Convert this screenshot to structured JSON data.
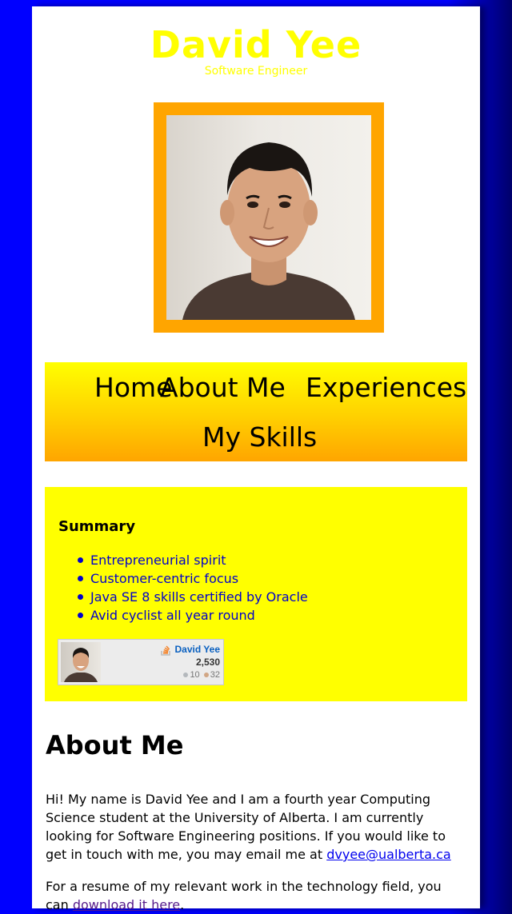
{
  "header": {
    "name": "David Yee",
    "subtitle": "Software Engineer"
  },
  "nav": {
    "items": [
      {
        "label": "Home"
      },
      {
        "label": "About Me"
      },
      {
        "label": "Experiences"
      },
      {
        "label": "My Skills"
      }
    ]
  },
  "summary": {
    "heading": "Summary",
    "items": [
      {
        "text": "Entrepreneurial spirit"
      },
      {
        "text": "Customer-centric focus"
      },
      {
        "text": "Java SE 8 skills certified by Oracle"
      },
      {
        "text": "Avid cyclist all year round"
      }
    ],
    "flair": {
      "name": "David Yee",
      "reputation": "2,530",
      "silver": "10",
      "bronze": "32"
    }
  },
  "about": {
    "heading": "About Me",
    "p1_text": "Hi! My name is David Yee and I am a fourth year Computing Science student at the University of Alberta. I am currently looking for Software Engineering positions. If you would like to get in touch with me, you may email me at ",
    "email": "dvyee@ualberta.ca",
    "p2_text": "For a resume of my relevant work in the technology field, you can ",
    "resume_link": "download it here",
    "p2_end": "."
  },
  "colors": {
    "background": "#0000ff",
    "accent_yellow": "#ffff00",
    "accent_orange": "#ffa500",
    "link_blue": "#0000cc"
  }
}
